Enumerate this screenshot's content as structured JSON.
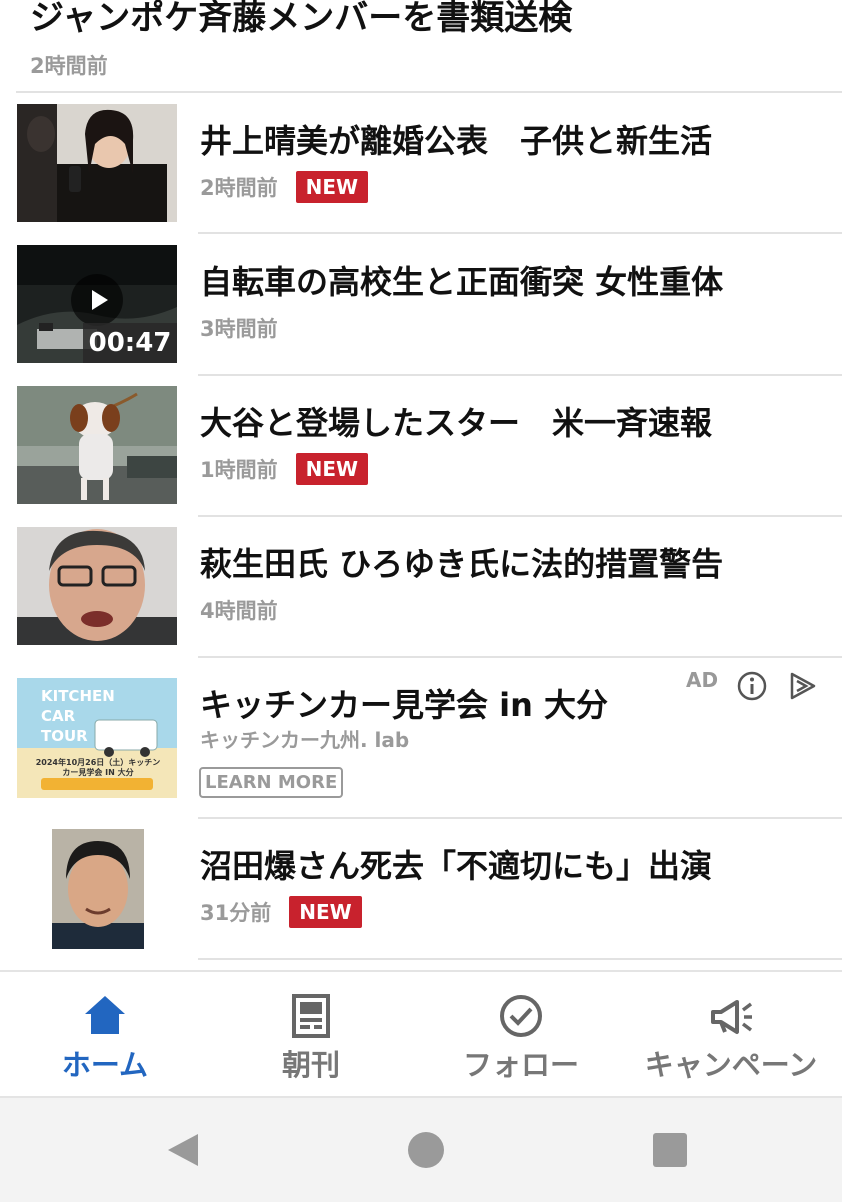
{
  "top_article": {
    "title": "ジャンポケ斉藤メンバーを書類送検",
    "time": "2時間前"
  },
  "articles": [
    {
      "title": "井上晴美が離婚公表　子供と新生活",
      "time": "2時間前",
      "badge": "NEW"
    },
    {
      "title": "自転車の高校生と正面衝突 女性重体",
      "time": "3時間前",
      "video_duration": "00:47"
    },
    {
      "title": "大谷と登場したスター　米一斉速報",
      "time": "1時間前",
      "badge": "NEW"
    },
    {
      "title": "萩生田氏 ひろゆき氏に法的措置警告",
      "time": "4時間前"
    }
  ],
  "ad": {
    "label": "AD",
    "title": "キッチンカー見学会 in 大分",
    "sponsor": "キッチンカー九州. lab",
    "cta": "LEARN MORE",
    "thumb_text": [
      "KITCHEN",
      "CAR",
      "TOUR"
    ],
    "thumb_caption": "2024年10月26日（土）キッチンカー見学会 IN 大分"
  },
  "last_article": {
    "title": "沼田爆さん死去「不適切にも」出演",
    "time": "31分前",
    "badge": "NEW"
  },
  "bottom_nav": [
    {
      "label": "ホーム",
      "icon": "home-icon",
      "active": true
    },
    {
      "label": "朝刊",
      "icon": "newspaper-icon",
      "active": false
    },
    {
      "label": "フォロー",
      "icon": "check-circle-icon",
      "active": false
    },
    {
      "label": "キャンペーン",
      "icon": "megaphone-icon",
      "active": false
    }
  ],
  "colors": {
    "accent": "#2266c0",
    "badge": "#c8222d",
    "muted": "#9a9a9a"
  }
}
